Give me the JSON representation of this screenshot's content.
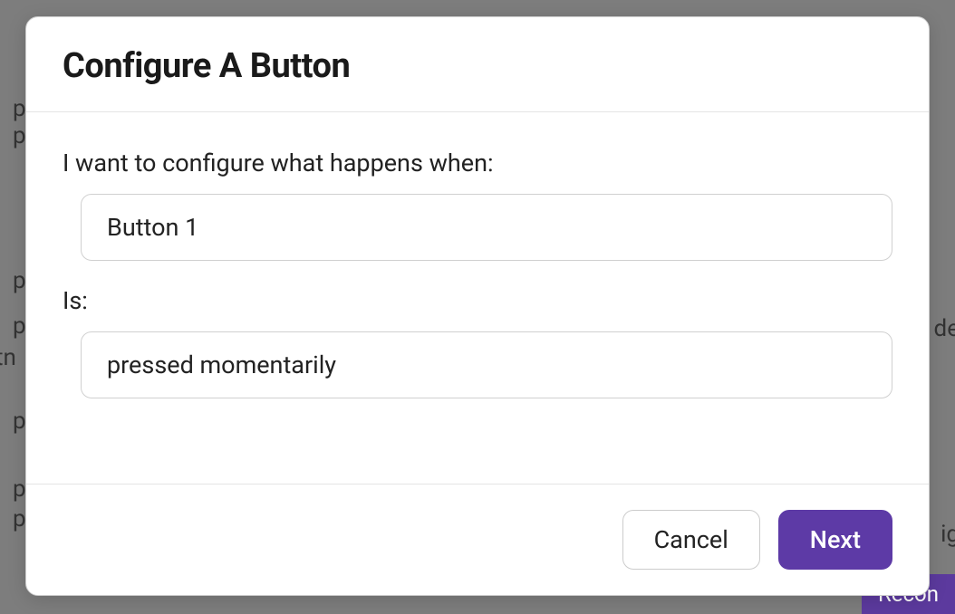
{
  "background": {
    "fragments": {
      "p1": "p",
      "p2": "p",
      "p3": "p",
      "p4": "p",
      "tn": "tn",
      "p5": "p",
      "p6": "p",
      "p7": "p",
      "de": "de",
      "ig": "ig"
    },
    "recon_button": "Recon"
  },
  "modal": {
    "title": "Configure A Button",
    "body": {
      "label_1": "I want to configure what happens when:",
      "select_1_value": "Button 1",
      "label_2": "Is:",
      "select_2_value": "pressed momentarily"
    },
    "footer": {
      "cancel_label": "Cancel",
      "next_label": "Next"
    }
  }
}
